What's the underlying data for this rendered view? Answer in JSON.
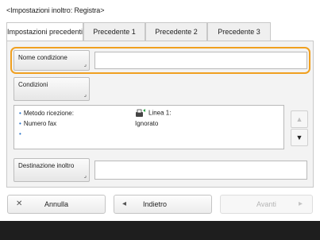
{
  "screen": {
    "title": "<Impostazioni inoltro: Registra>"
  },
  "tabs": [
    {
      "label": "Impostazioni precedenti",
      "active": true
    },
    {
      "label": "Precedente 1",
      "active": false
    },
    {
      "label": "Precedente 2",
      "active": false
    },
    {
      "label": "Precedente 3",
      "active": false
    }
  ],
  "form": {
    "condition_name_label": "Nome condizione",
    "condition_name_value": "",
    "conditions_label": "Condizioni",
    "destination_label": "Destinazione inoltro",
    "destination_value": ""
  },
  "conditions_info": {
    "rows": [
      {
        "label": "Metodo ricezione:",
        "value": "Linea 1:"
      },
      {
        "label": "Numero fax",
        "value": "Ignorato"
      },
      {
        "label": "",
        "value": ""
      }
    ]
  },
  "buttons": {
    "cancel": "Annulla",
    "back": "Indietro",
    "next": "Avanti"
  },
  "colors": {
    "highlight": "#f0a020",
    "bullet": "#2a73c9"
  }
}
